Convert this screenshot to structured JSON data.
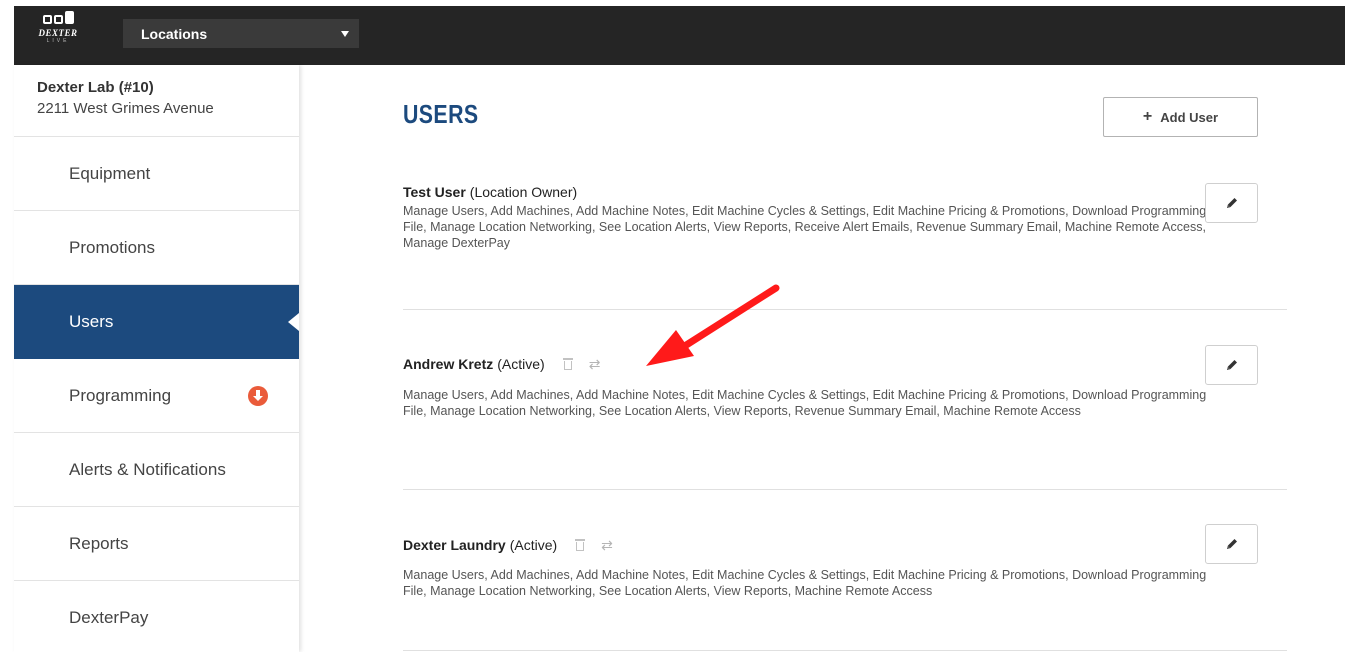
{
  "header": {
    "logo_text": "DEXTER",
    "logo_sub": "LIVE",
    "location_select": "Locations"
  },
  "sidebar": {
    "location_name": "Dexter Lab (#10)",
    "location_address": "2211 West Grimes Avenue",
    "items": [
      {
        "label": "Equipment"
      },
      {
        "label": "Promotions"
      },
      {
        "label": "Users",
        "active": true
      },
      {
        "label": "Programming",
        "badge_icon": "download-arrow-icon"
      },
      {
        "label": "Alerts & Notifications"
      },
      {
        "label": "Reports"
      },
      {
        "label": "DexterPay"
      }
    ]
  },
  "main": {
    "title": "USERS",
    "add_user_label": "Add User",
    "users": [
      {
        "name": "Test User",
        "role": "(Location Owner)",
        "permissions": "Manage Users, Add Machines, Add Machine Notes, Edit Machine Cycles & Settings, Edit Machine Pricing & Promotions, Download Programming File, Manage Location Networking, See Location Alerts, View Reports, Receive Alert Emails, Revenue Summary Email, Machine Remote Access, Manage DexterPay"
      },
      {
        "name": "Andrew Kretz",
        "role": "(Active)",
        "permissions": "Manage Users, Add Machines, Add Machine Notes, Edit Machine Cycles & Settings, Edit Machine Pricing & Promotions, Download Programming File, Manage Location Networking, See Location Alerts, View Reports, Revenue Summary Email, Machine Remote Access"
      },
      {
        "name": "Dexter Laundry",
        "role": "(Active)",
        "permissions": "Manage Users, Add Machines, Add Machine Notes, Edit Machine Cycles & Settings, Edit Machine Pricing & Promotions, Download Programming File, Manage Location Networking, See Location Alerts, View Reports, Machine Remote Access"
      }
    ]
  },
  "colors": {
    "topbar": "#252525",
    "active_nav": "#1c4a7e",
    "title": "#1c4a7e",
    "badge": "#ea5b3a",
    "annotation_arrow": "#ff1a1a"
  }
}
